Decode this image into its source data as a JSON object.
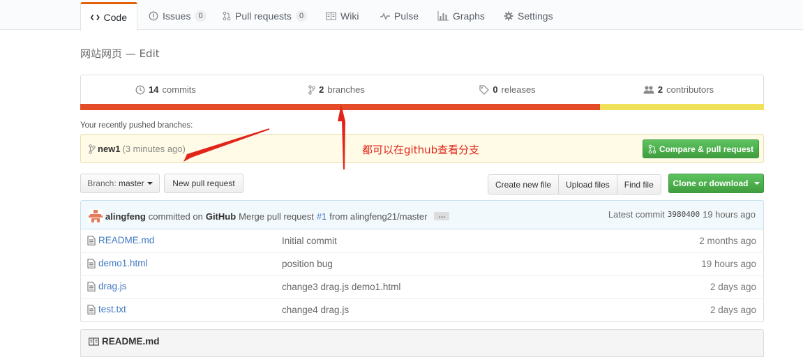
{
  "nav": {
    "tabs": [
      {
        "label": "Code",
        "icon": "code-icon",
        "selected": true
      },
      {
        "label": "Issues",
        "icon": "issue-icon",
        "count": "0"
      },
      {
        "label": "Pull requests",
        "icon": "pull-request-icon",
        "count": "0"
      },
      {
        "label": "Wiki",
        "icon": "book-icon"
      },
      {
        "label": "Pulse",
        "icon": "pulse-icon"
      },
      {
        "label": "Graphs",
        "icon": "graph-icon"
      },
      {
        "label": "Settings",
        "icon": "gear-icon"
      }
    ]
  },
  "repo": {
    "description": "网站网页",
    "edit_link": "— Edit"
  },
  "summary": {
    "commits": {
      "count": "14",
      "label": "commits"
    },
    "branches": {
      "count": "2",
      "label": "branches"
    },
    "releases": {
      "count": "0",
      "label": "releases"
    },
    "contributors": {
      "count": "2",
      "label": "contributors"
    }
  },
  "language_bar": [
    {
      "color": "#e34c26",
      "share": 0.76
    },
    {
      "color": "#f1e05a",
      "share": 0.24
    }
  ],
  "recent_branches": {
    "label": "Your recently pushed branches:",
    "branch": "new1",
    "ago": "(3 minutes ago)",
    "compare_button": "Compare & pull request"
  },
  "annotation": {
    "text": "都可以在github查看分支",
    "color": "#e1251b"
  },
  "file_nav": {
    "branch_prefix": "Branch:",
    "branch_name": "master",
    "new_pull_request": "New pull request",
    "create_new_file": "Create new file",
    "upload_files": "Upload files",
    "find_file": "Find file",
    "clone_download": "Clone or download"
  },
  "latest_commit": {
    "author": "alingfeng",
    "committed_on": "committed on",
    "platform": "GitHub",
    "message_prefix": "Merge pull request",
    "pr_number": "#1",
    "message_suffix": "from alingfeng21/master",
    "ellipsis": "…",
    "latest_label": "Latest commit",
    "sha": "3980400",
    "time": "19 hours ago"
  },
  "files": [
    {
      "name": "README.md",
      "message": "Initial commit",
      "age": "2 months ago"
    },
    {
      "name": "demo1.html",
      "message": "position bug",
      "age": "19 hours ago"
    },
    {
      "name": "drag.js",
      "message": "change3 drag.js demo1.html",
      "age": "2 days ago"
    },
    {
      "name": "test.txt",
      "message": "change4 drag.js",
      "age": "2 days ago"
    }
  ],
  "readme": {
    "title": "README.md"
  }
}
